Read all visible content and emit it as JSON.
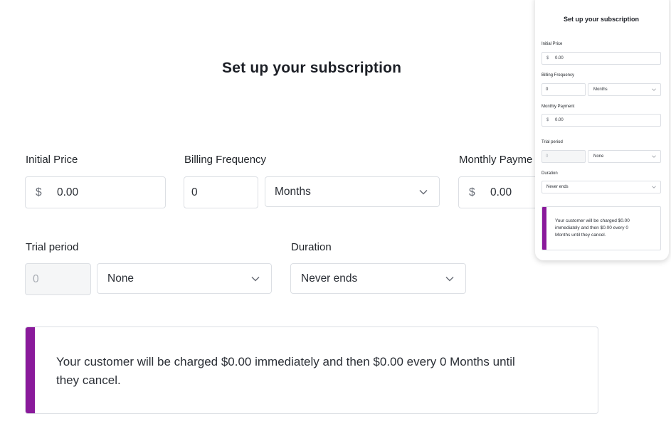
{
  "title": "Set up your subscription",
  "initial_price": {
    "label": "Initial Price",
    "currency": "$",
    "value": "0.00"
  },
  "billing_frequency": {
    "label": "Billing Frequency",
    "count": "0",
    "unit": "Months"
  },
  "monthly_payment": {
    "label": "Monthly Payme",
    "currency": "$",
    "value": "0.00"
  },
  "trial_period": {
    "label": "Trial period",
    "count_placeholder": "0",
    "unit": "None"
  },
  "duration": {
    "label": "Duration",
    "value": "Never ends"
  },
  "summary": {
    "line1": "Your customer will be charged $0.00 immediately and then $0.00 every 0 Months until",
    "line2": "they cancel.",
    "accent_color": "#8a1a9b"
  },
  "preview": {
    "title": "Set up your subscription",
    "initial_price_label": "Initial Price",
    "initial_price_currency": "$",
    "initial_price_value": "0.00",
    "billing_frequency_label": "Billing Frequency",
    "billing_count": "0",
    "billing_unit": "Months",
    "monthly_payment_label": "Monthly Payment",
    "monthly_payment_currency": "$",
    "monthly_payment_value": "0.00",
    "trial_period_label": "Trial period",
    "trial_count_placeholder": "0",
    "trial_unit": "None",
    "duration_label": "Duration",
    "duration_value": "Never ends",
    "summary_line1": "Your customer will be charged $0.00",
    "summary_line2": "immediately and then $0.00 every 0",
    "summary_line3": "Months until they cancel."
  }
}
